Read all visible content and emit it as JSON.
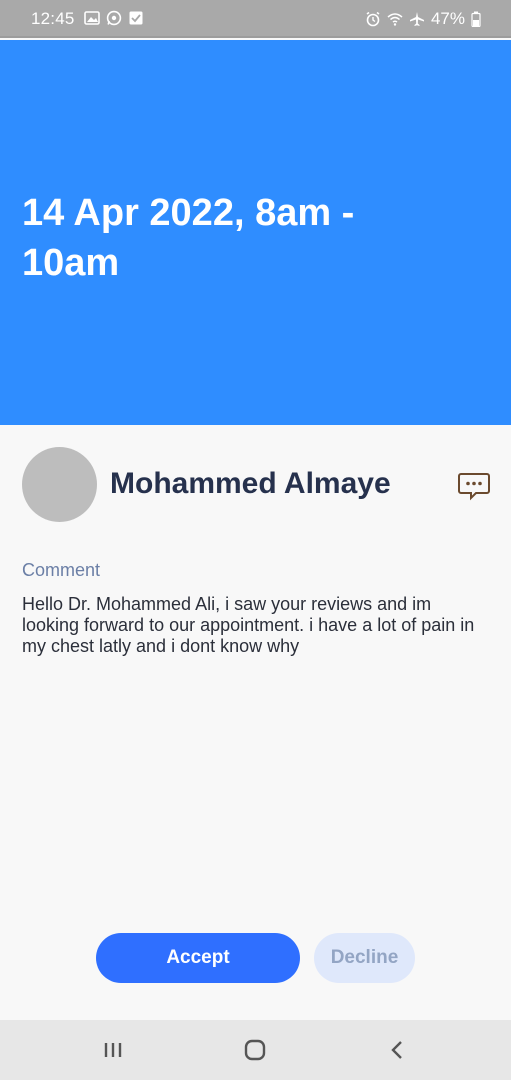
{
  "status_bar": {
    "time": "12:45",
    "battery": "47%",
    "left_icons": [
      "image-icon",
      "whatsapp-icon",
      "checkbox-icon"
    ],
    "right_icons": [
      "alarm-icon",
      "wifi-icon",
      "airplane-icon",
      "battery-icon"
    ]
  },
  "header": {
    "title": "14 Apr 2022, 8am - 10am",
    "background_color": "#2f8dff"
  },
  "patient": {
    "name": "Mohammed Almaye",
    "chat_icon": "chat-bubble-icon"
  },
  "comment": {
    "label": "Comment",
    "text": "Hello Dr. Mohammed Ali, i saw your reviews and im looking forward to our appointment. i have a lot of pain in my chest latly and i dont know why"
  },
  "actions": {
    "accept_label": "Accept",
    "decline_label": "Decline",
    "accept_color": "#2f6fff",
    "decline_color": "#dfe8fb"
  },
  "nav_bar": {
    "items": [
      "recent-apps-icon",
      "home-icon",
      "back-icon"
    ]
  }
}
